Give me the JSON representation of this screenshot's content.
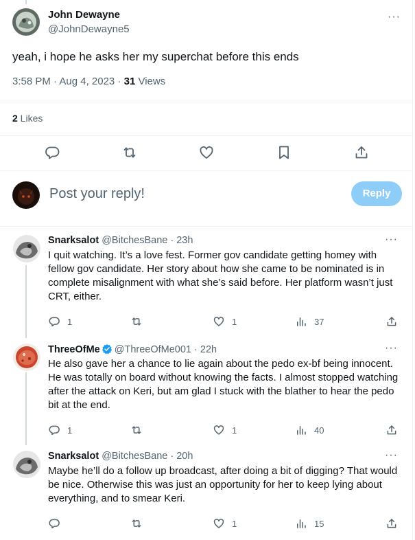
{
  "main_tweet": {
    "author_name": "John Dewayne",
    "author_handle": "@JohnDewayne5",
    "text": "yeah, i hope he asks her my superchat before this ends",
    "timestamp": "3:58 PM · Aug 4, 2023 · ",
    "views_count": "31",
    "views_label": " Views",
    "likes_count": "2",
    "likes_label": " Likes",
    "actions": [
      "reply-icon",
      "retweet-icon",
      "like-icon",
      "bookmark-icon",
      "share-icon"
    ]
  },
  "more_label": "···",
  "reply_composer": {
    "placeholder": "Post your reply!",
    "button_label": "Reply"
  },
  "replies": [
    {
      "name": "Snarksalot",
      "handle_time": "@BitchesBane · 23h",
      "verified": false,
      "text": "I quit watching. It’s a love fest. Former gov candidate getting homey with fellow gov candidate. Her story about how she came to be nominated is in complete misalignment with what she’s said before. Her platform wasn’t just CRT, either.",
      "reply_count": "1",
      "retweet_count": "",
      "like_count": "1",
      "view_count": "37"
    },
    {
      "name": "ThreeOfMe",
      "handle_time": "@ThreeOfMe001 · 22h",
      "verified": true,
      "text": "He also gave her a chance to lie again about the pedo ex-bf being innocent. He was totally on board without knowing the facts. I almost stopped watching after the attack on Keri, but am glad I stuck with the blather to hear the pedo bit at the end.",
      "reply_count": "1",
      "retweet_count": "",
      "like_count": "1",
      "view_count": "40"
    },
    {
      "name": "Snarksalot",
      "handle_time": "@BitchesBane · 20h",
      "verified": false,
      "text": "Maybe he’ll do a follow up broadcast, after doing a bit of digging? That would be nice. Otherwise this was just an opportunity for her to keep lying about everything, and to smear Keri.",
      "reply_count": "",
      "retweet_count": "",
      "like_count": "1",
      "view_count": "15"
    }
  ],
  "colors": {
    "text": "#0f1419",
    "secondary": "#536471",
    "reply_button": "#8ecdf8",
    "divider": "#eff3f4",
    "verified": "#1d9bf0"
  }
}
